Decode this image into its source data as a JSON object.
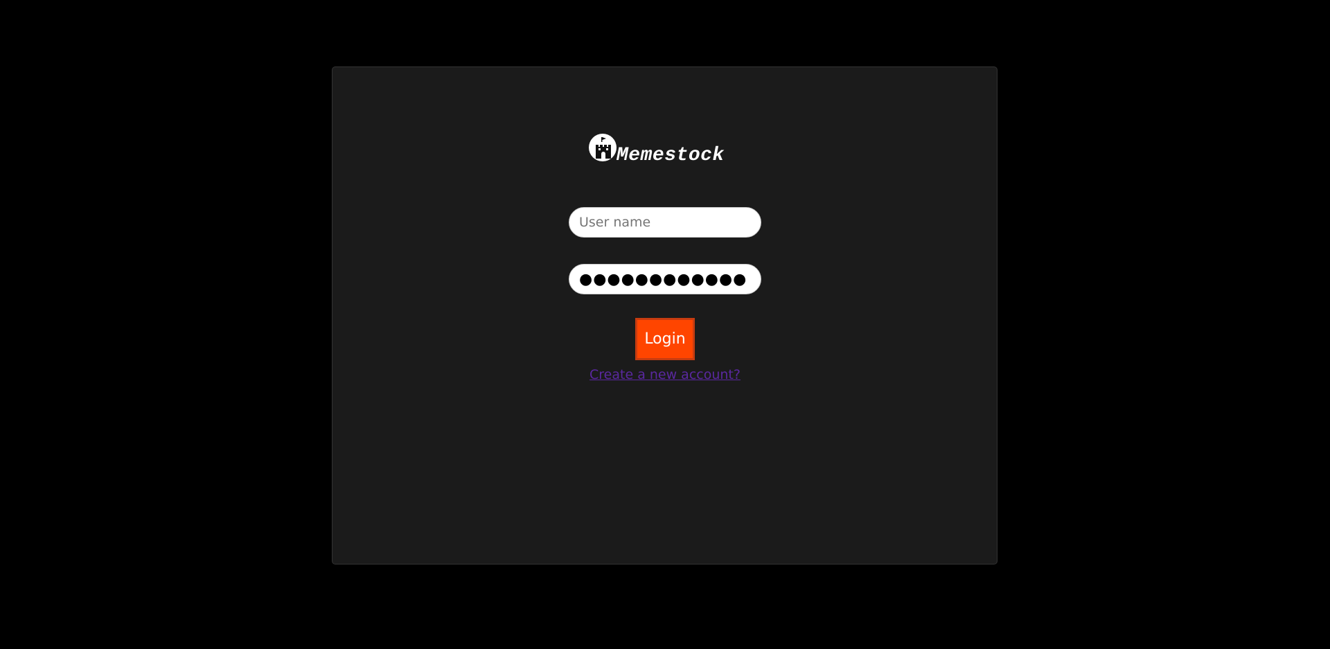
{
  "app": {
    "name": "Memestock",
    "logo_icon": "castle-icon"
  },
  "form": {
    "username_placeholder": "User name",
    "username_value": "",
    "password_value": "●●●●●●●●●●●●",
    "login_label": "Login",
    "create_account_label": "Create a new account?"
  },
  "colors": {
    "page_background": "#000000",
    "card_background": "#1b1b1b",
    "login_button": "#ff4500",
    "login_button_border": "#c83c10",
    "link": "#5a28a0"
  }
}
